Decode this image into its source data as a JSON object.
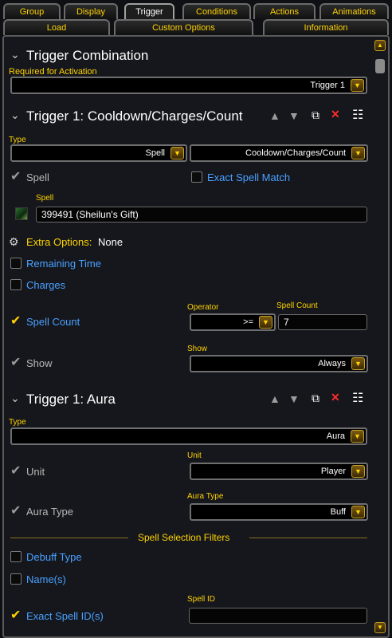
{
  "tabs_row1": [
    {
      "label": "Group"
    },
    {
      "label": "Display"
    },
    {
      "label": "Trigger",
      "active": true
    },
    {
      "label": "Conditions"
    },
    {
      "label": "Actions"
    },
    {
      "label": "Animations"
    }
  ],
  "tabs_row2": [
    {
      "label": "Load"
    },
    {
      "label": "Custom Options"
    },
    {
      "label": "Information"
    }
  ],
  "combination": {
    "title": "Trigger Combination",
    "required_label": "Required for Activation",
    "value": "Trigger 1"
  },
  "trigger1": {
    "title": "Trigger 1: Cooldown/Charges/Count",
    "type_label": "Type",
    "type_value": "Spell",
    "subtype_value": "Cooldown/Charges/Count",
    "spell_cb_label": "Spell",
    "exact_match_label": "Exact Spell Match",
    "spell_label": "Spell",
    "spell_value": "399491 (Sheilun's Gift)",
    "extra_options_label": "Extra Options:",
    "extra_options_value": "None",
    "remaining_time_label": "Remaining Time",
    "charges_label": "Charges",
    "spell_count_label": "Spell Count",
    "operator_label": "Operator",
    "operator_value": ">=",
    "spell_count_field_label": "Spell Count",
    "spell_count_value": "7",
    "show_cb_label": "Show",
    "show_label": "Show",
    "show_value": "Always"
  },
  "trigger1_aura": {
    "title": "Trigger 1: Aura",
    "type_label": "Type",
    "type_value": "Aura",
    "unit_cb_label": "Unit",
    "unit_label": "Unit",
    "unit_value": "Player",
    "aura_type_cb_label": "Aura Type",
    "aura_type_label": "Aura Type",
    "aura_type_value": "Buff",
    "filters_title": "Spell Selection Filters",
    "debuff_type_label": "Debuff Type",
    "names_label": "Name(s)",
    "exact_spell_ids_label": "Exact Spell ID(s)",
    "spell_id_label": "Spell ID",
    "spell_id_value": ""
  },
  "icons": {
    "collapse": "chevron-down-icon",
    "move_up": "arrow-up-icon",
    "move_down": "arrow-down-icon",
    "duplicate": "duplicate-icon",
    "delete": "delete-x-icon",
    "notes": "notes-icon",
    "gear": "gear-icon"
  },
  "colors": {
    "accent_gold": "#ffd200",
    "label_blue": "#4aa0ff",
    "delete_red": "#ff2b2b"
  }
}
